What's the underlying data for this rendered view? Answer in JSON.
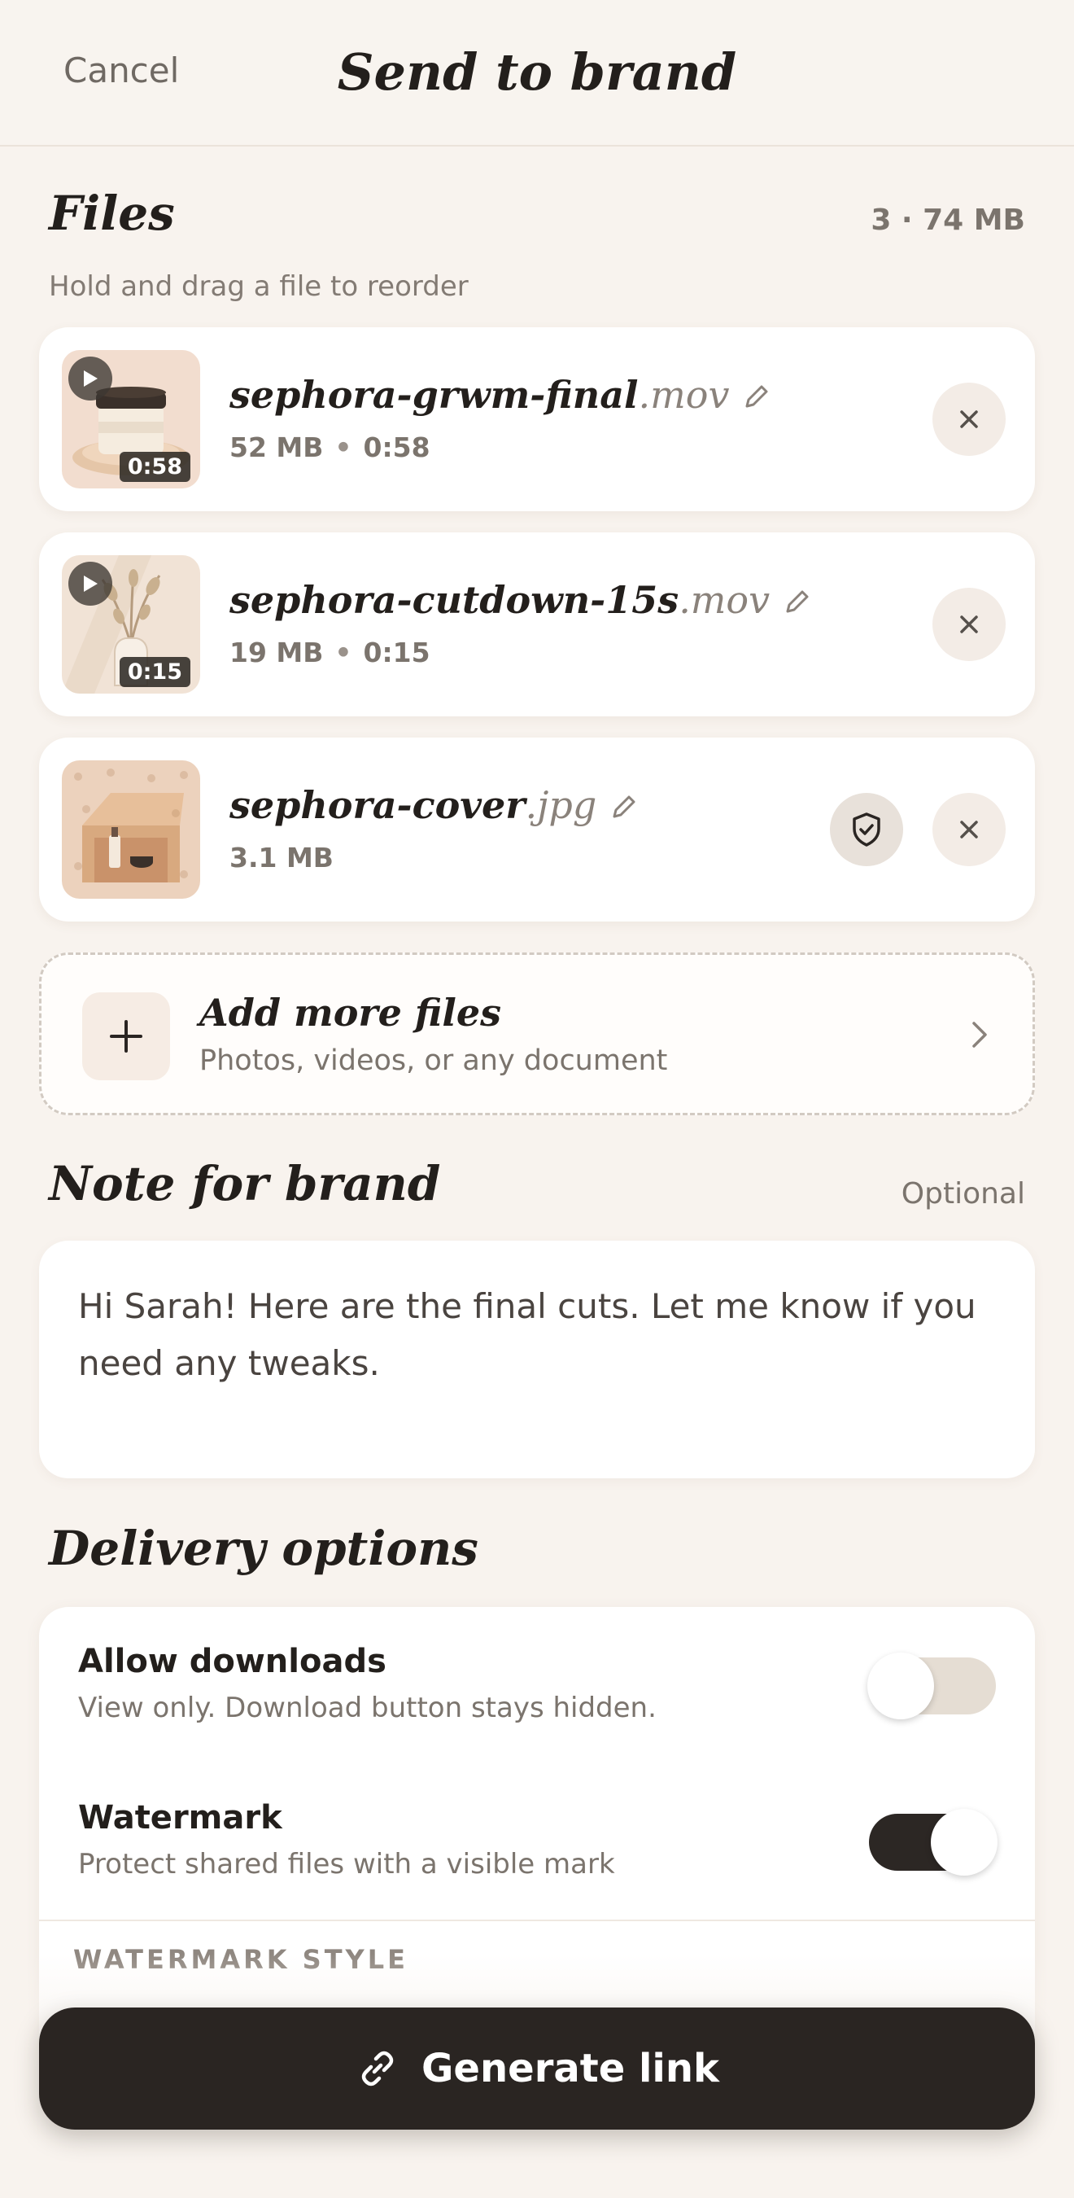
{
  "header": {
    "cancel_label": "Cancel",
    "title": "Send to brand"
  },
  "files_section": {
    "title": "Files",
    "summary": "3 · 74 MB",
    "hint": "Hold and drag a file to reorder",
    "items": [
      {
        "base": "sephora-grwm-final",
        "ext": ".mov",
        "size": "52 MB",
        "duration": "0:58",
        "thumb_duration": "0:58",
        "type": "video"
      },
      {
        "base": "sephora-cutdown-15s",
        "ext": ".mov",
        "size": "19 MB",
        "duration": "0:15",
        "thumb_duration": "0:15",
        "type": "video"
      },
      {
        "base": "sephora-cover",
        "ext": ".jpg",
        "size": "3.1 MB",
        "type": "image",
        "protected": true
      }
    ]
  },
  "add_more": {
    "title": "Add more files",
    "subtitle": "Photos, videos, or any document"
  },
  "note_section": {
    "title": "Note for brand",
    "optional_label": "Optional",
    "text": "Hi Sarah! Here are the final cuts. Let me know if you need any tweaks."
  },
  "delivery": {
    "title": "Delivery options",
    "options": [
      {
        "title": "Allow downloads",
        "subtitle": "View only. Download button stays hidden.",
        "enabled": false
      },
      {
        "title": "Watermark",
        "subtitle": "Protect shared files with a visible mark",
        "enabled": true
      }
    ],
    "watermark_style_label": "WATERMARK STYLE"
  },
  "cta": {
    "label": "Generate link",
    "icon": "link-icon"
  },
  "colors": {
    "background": "#f8f3ee",
    "primary": "#2a2522",
    "muted": "#7b746d",
    "card": "#ffffff"
  }
}
